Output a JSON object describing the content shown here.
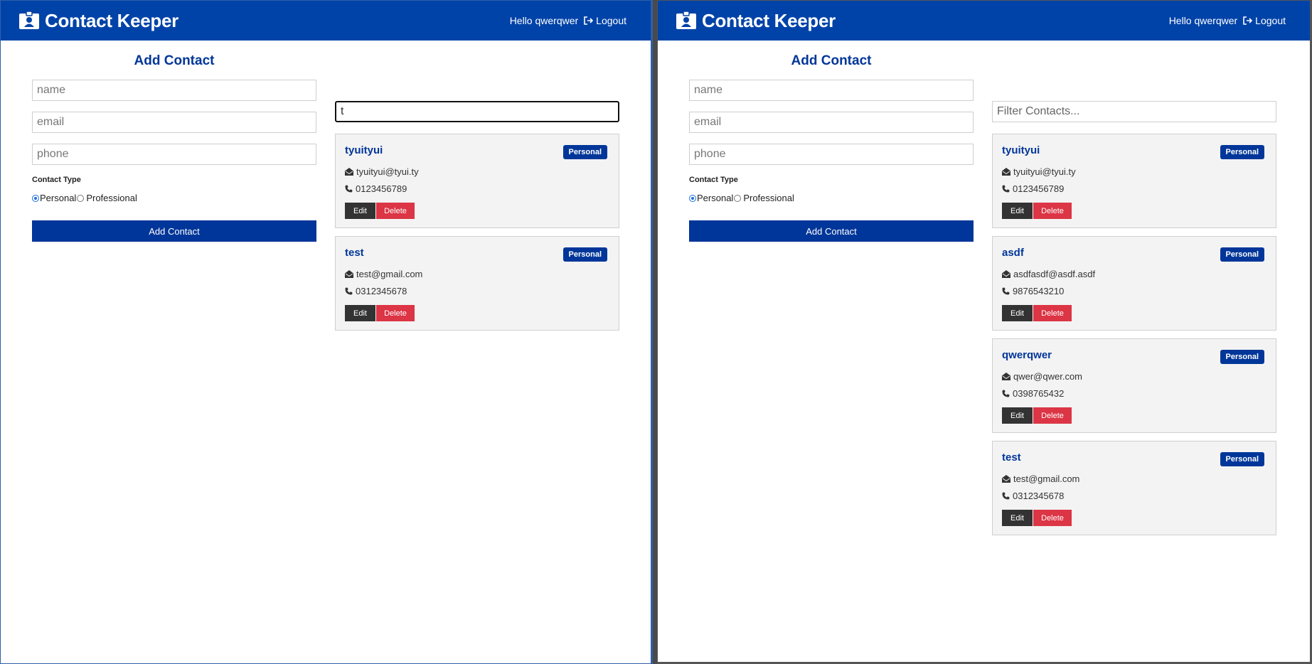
{
  "app": {
    "brand": "Contact Keeper",
    "greeting": "Hello qwerqwer",
    "logout": "Logout"
  },
  "form": {
    "title": "Add Contact",
    "name_placeholder": "name",
    "email_placeholder": "email",
    "phone_placeholder": "phone",
    "type_label": "Contact Type",
    "personal": "Personal",
    "professional": "Professional",
    "selected_type": "Personal",
    "submit": "Add Contact"
  },
  "left": {
    "filter_value": "t",
    "contacts": [
      {
        "name": "tyuityui",
        "type": "Personal",
        "email": "tyuityui@tyui.ty",
        "phone": "0123456789"
      },
      {
        "name": "test",
        "type": "Personal",
        "email": "test@gmail.com",
        "phone": "0312345678"
      }
    ]
  },
  "right": {
    "filter_placeholder": "Filter Contacts...",
    "contacts": [
      {
        "name": "tyuityui",
        "type": "Personal",
        "email": "tyuityui@tyui.ty",
        "phone": "0123456789"
      },
      {
        "name": "asdf",
        "type": "Personal",
        "email": "asdfasdf@asdf.asdf",
        "phone": "9876543210"
      },
      {
        "name": "qwerqwer",
        "type": "Personal",
        "email": "qwer@qwer.com",
        "phone": "0398765432"
      },
      {
        "name": "test",
        "type": "Personal",
        "email": "test@gmail.com",
        "phone": "0312345678"
      }
    ]
  },
  "buttons": {
    "edit": "Edit",
    "delete": "Delete"
  },
  "icons": {
    "brand": "id-badge-icon",
    "logout": "sign-out-icon",
    "email": "envelope-open-icon",
    "phone": "phone-icon"
  },
  "colors": {
    "navbar": "#0043a8",
    "primary": "#003699",
    "danger": "#dc3545",
    "dark": "#333333"
  }
}
